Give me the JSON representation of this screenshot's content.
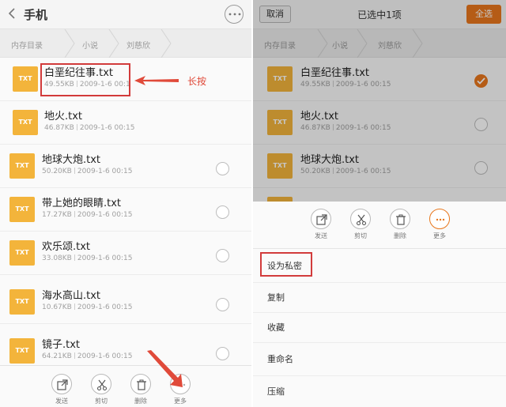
{
  "left": {
    "header": {
      "title": "手机"
    },
    "breadcrumb": [
      "内存目录",
      "小说",
      "刘慈欣"
    ],
    "files": [
      {
        "name": "白垩纪往事.txt",
        "size": "49.55KB",
        "date": "2009-1-6 00:1",
        "icon": "TXT"
      },
      {
        "name": "地火.txt",
        "size": "46.87KB",
        "date": "2009-1-6 00:15",
        "icon": "TXT"
      },
      {
        "name": "地球大炮.txt",
        "size": "50.20KB",
        "date": "2009-1-6 00:15",
        "icon": "TXT"
      },
      {
        "name": "带上她的眼睛.txt",
        "size": "17.27KB",
        "date": "2009-1-6 00:15",
        "icon": "TXT"
      },
      {
        "name": "欢乐颂.txt",
        "size": "33.08KB",
        "date": "2009-1-6 00:15",
        "icon": "TXT"
      },
      {
        "name": "海水高山.txt",
        "size": "10.67KB",
        "date": "2009-1-6 00:15",
        "icon": "TXT"
      },
      {
        "name": "镜子.txt",
        "size": "64.21KB",
        "date": "2009-1-6 00:15",
        "icon": "TXT"
      }
    ],
    "annotation": "长按",
    "toolbar": [
      {
        "label": "发送",
        "icon": "share-icon"
      },
      {
        "label": "剪切",
        "icon": "scissors-icon"
      },
      {
        "label": "删除",
        "icon": "trash-icon"
      },
      {
        "label": "更多",
        "icon": "more-icon"
      }
    ]
  },
  "right": {
    "header": {
      "cancel": "取消",
      "title": "已选中1项",
      "select_all": "全选"
    },
    "files": [
      {
        "name": "白垩纪往事.txt",
        "size": "49.55KB",
        "date": "2009-1-6 00:15",
        "icon": "TXT",
        "checked": true
      },
      {
        "name": "地火.txt",
        "size": "46.87KB",
        "date": "2009-1-6 00:15",
        "icon": "TXT",
        "checked": false
      },
      {
        "name": "地球大炮.txt",
        "size": "50.20KB",
        "date": "2009-1-6 00:15",
        "icon": "TXT",
        "checked": false
      }
    ],
    "toolbar": [
      {
        "label": "发送",
        "icon": "share-icon"
      },
      {
        "label": "剪切",
        "icon": "scissors-icon"
      },
      {
        "label": "删除",
        "icon": "trash-icon"
      },
      {
        "label": "更多",
        "icon": "more-icon"
      }
    ],
    "menu": [
      "设为私密",
      "复制",
      "收藏",
      "重命名",
      "压缩"
    ]
  },
  "colors": {
    "accent": "#e8771d",
    "file_icon": "#f3b43b",
    "annotation": "#d23b3b"
  }
}
